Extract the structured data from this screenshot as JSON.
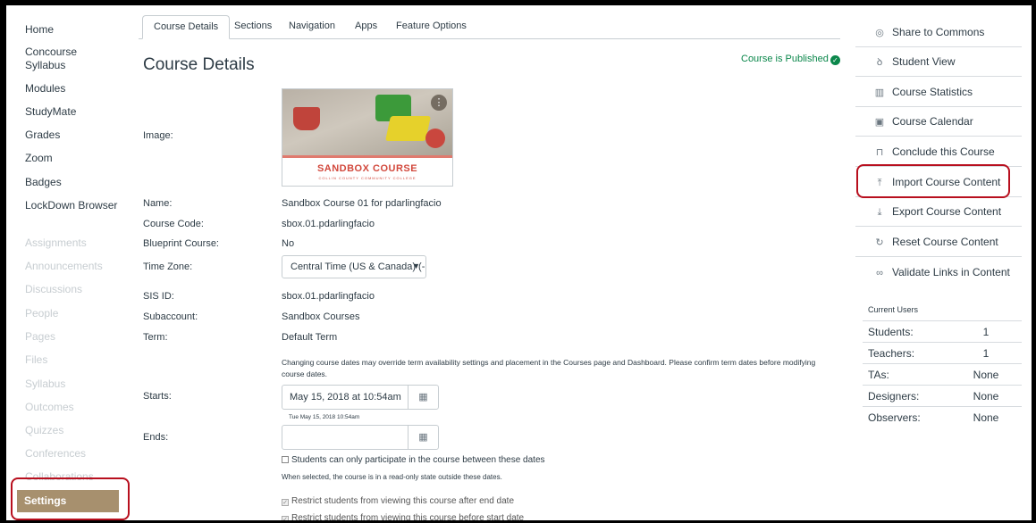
{
  "nav": {
    "items": [
      {
        "label": "Home",
        "state": "enabled"
      },
      {
        "label": "Concourse Syllabus",
        "state": "enabled"
      },
      {
        "label": "Modules",
        "state": "enabled"
      },
      {
        "label": "StudyMate",
        "state": "enabled"
      },
      {
        "label": "Grades",
        "state": "enabled"
      },
      {
        "label": "Zoom",
        "state": "enabled"
      },
      {
        "label": "Badges",
        "state": "enabled"
      },
      {
        "label": "LockDown Browser",
        "state": "enabled"
      },
      {
        "label": "Assignments",
        "state": "disabled"
      },
      {
        "label": "Announcements",
        "state": "disabled"
      },
      {
        "label": "Discussions",
        "state": "disabled"
      },
      {
        "label": "People",
        "state": "disabled"
      },
      {
        "label": "Pages",
        "state": "disabled"
      },
      {
        "label": "Files",
        "state": "disabled"
      },
      {
        "label": "Syllabus",
        "state": "disabled"
      },
      {
        "label": "Outcomes",
        "state": "disabled"
      },
      {
        "label": "Quizzes",
        "state": "disabled"
      },
      {
        "label": "Conferences",
        "state": "disabled"
      },
      {
        "label": "Collaborations",
        "state": "disabled"
      },
      {
        "label": "Settings",
        "state": "active"
      }
    ]
  },
  "tabs": [
    "Course Details",
    "Sections",
    "Navigation",
    "Apps",
    "Feature Options"
  ],
  "page": {
    "title": "Course Details",
    "published": "Course is Published"
  },
  "details": {
    "image_label": "Image:",
    "image_title": "SANDBOX COURSE",
    "image_subtitle": "COLLIN COUNTY COMMUNITY COLLEGE",
    "name_label": "Name:",
    "name_value": "Sandbox Course 01 for pdarlingfacio",
    "code_label": "Course Code:",
    "code_value": "sbox.01.pdarlingfacio",
    "blueprint_label": "Blueprint Course:",
    "blueprint_value": "No",
    "timezone_label": "Time Zone:",
    "timezone_value": "Central Time (US & Canada) (-",
    "sis_label": "SIS ID:",
    "sis_value": "sbox.01.pdarlingfacio",
    "subaccount_label": "Subaccount:",
    "subaccount_value": "Sandbox Courses",
    "term_label": "Term:",
    "term_value": "Default Term",
    "dates_note": "Changing course dates may override term availability settings and placement in the Courses page and Dashboard. Please confirm term dates before modifying course dates.",
    "starts_label": "Starts:",
    "starts_value": "May 15, 2018 at 10:54am",
    "starts_hint": "Tue May 15, 2018 10:54am",
    "ends_label": "Ends:",
    "ends_value": "",
    "cb_participate": "Students can only participate in the course between these dates",
    "cb_note": "When selected, the course is in a read-only state outside these dates.",
    "cb_after_end": "Restrict students from viewing this course after end date",
    "cb_before_start": "Restrict students from viewing this course before start date"
  },
  "sidebar": {
    "items": [
      {
        "label": "Share to Commons",
        "icon": "commons-icon"
      },
      {
        "label": "Student View",
        "icon": "student-view-icon"
      },
      {
        "label": "Course Statistics",
        "icon": "statistics-icon"
      },
      {
        "label": "Course Calendar",
        "icon": "calendar-icon"
      },
      {
        "label": "Conclude this Course",
        "icon": "lock-icon"
      },
      {
        "label": "Import Course Content",
        "icon": "upload-icon"
      },
      {
        "label": "Export Course Content",
        "icon": "download-icon"
      },
      {
        "label": "Reset Course Content",
        "icon": "reset-icon"
      },
      {
        "label": "Validate Links in Content",
        "icon": "link-icon"
      }
    ],
    "current_users_title": "Current Users",
    "users": [
      {
        "label": "Students:",
        "value": "1"
      },
      {
        "label": "Teachers:",
        "value": "1"
      },
      {
        "label": "TAs:",
        "value": "None"
      },
      {
        "label": "Designers:",
        "value": "None"
      },
      {
        "label": "Observers:",
        "value": "None"
      }
    ]
  },
  "colors": {
    "accent_active": "#a7906e",
    "published_green": "#0b874b",
    "annotation_red": "#b80f1e",
    "disabled_text": "#c7cdd1"
  }
}
